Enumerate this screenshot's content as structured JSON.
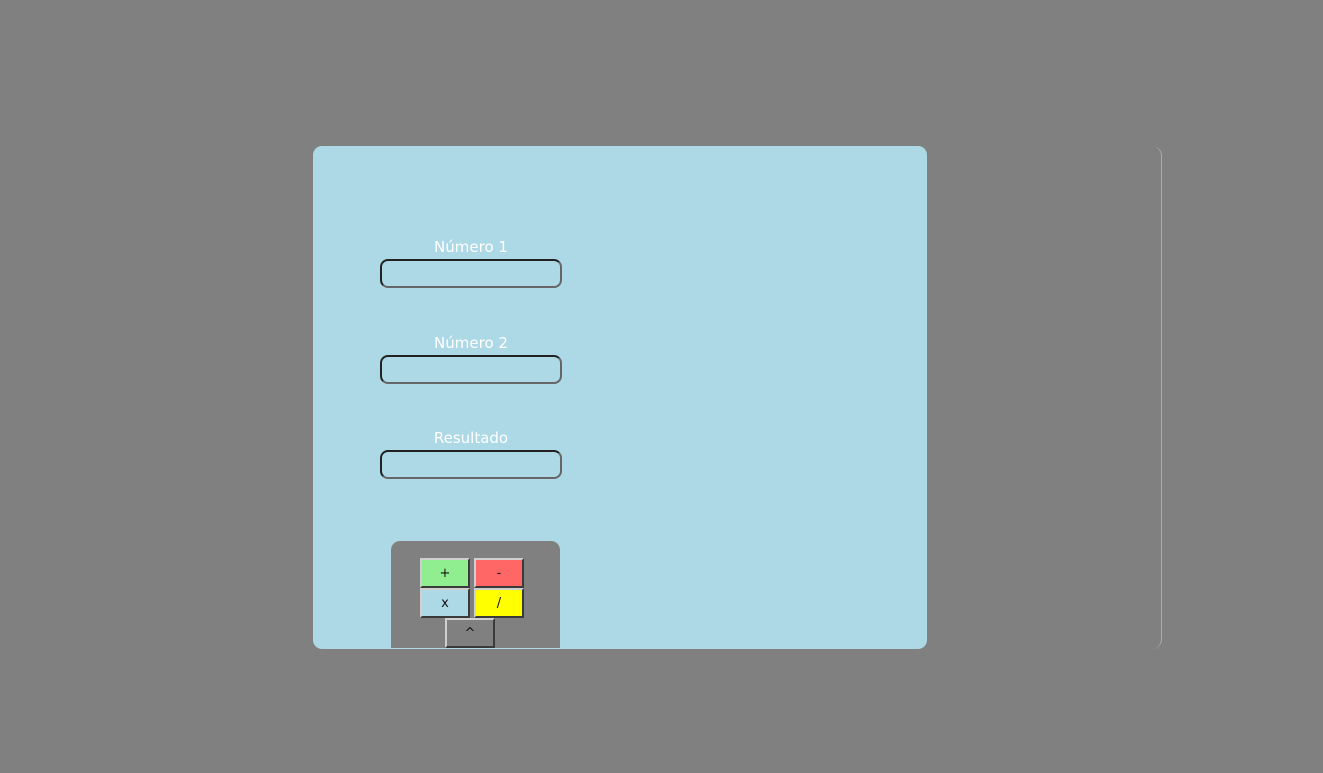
{
  "form": {
    "fields": [
      {
        "label": "Número 1",
        "value": "",
        "placeholder": ""
      },
      {
        "label": "Número 2",
        "value": "",
        "placeholder": ""
      },
      {
        "label": "Resultado",
        "value": "",
        "placeholder": ""
      }
    ]
  },
  "operations": {
    "add": {
      "label": "+",
      "color": "#90ee90"
    },
    "subtract": {
      "label": "-",
      "color": "#ff6666"
    },
    "multiply": {
      "label": "x",
      "color": "#add8e6"
    },
    "divide": {
      "label": "/",
      "color": "#ffff00"
    },
    "power": {
      "label": "^",
      "color": "#808080"
    }
  },
  "colors": {
    "background": "#808080",
    "panel": "#add8e6",
    "label_text": "#ffffff"
  }
}
